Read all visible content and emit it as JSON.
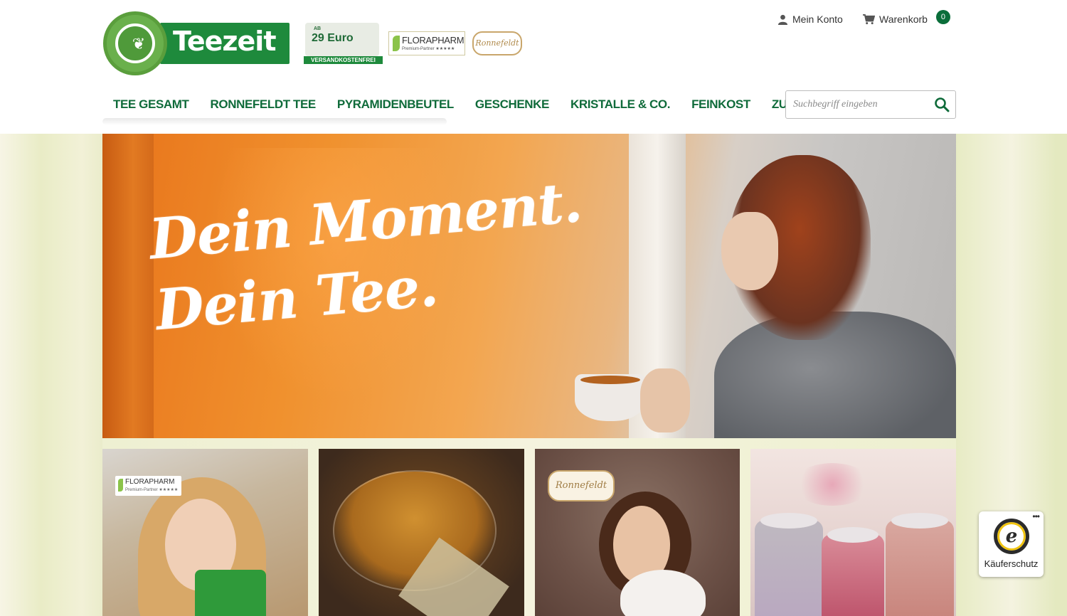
{
  "header": {
    "logo_text": "Teezeit",
    "shipping_badge": {
      "prefix": "AB",
      "amount": "29 Euro",
      "strip": "VERSANDKOSTENFREI"
    },
    "florapharm_badge": {
      "name": "FLORAPHARM",
      "sub": "Premium-Partner ★★★★★"
    },
    "ronnefeldt_badge": "Ronnefeldt",
    "account_label": "Mein Konto",
    "cart_label": "Warenkorb",
    "cart_count": "0"
  },
  "nav": {
    "items": [
      {
        "label": "TEE GESAMT"
      },
      {
        "label": "RONNEFELDT TEE"
      },
      {
        "label": "PYRAMIDENBEUTEL"
      },
      {
        "label": "GESCHENKE"
      },
      {
        "label": "KRISTALLE & CO."
      },
      {
        "label": "FEINKOST"
      },
      {
        "label": "ZUBEHÖR"
      }
    ]
  },
  "search": {
    "placeholder": "Suchbegriff eingeben",
    "value": ""
  },
  "hero": {
    "line1": "Dein Moment.",
    "line2": "Dein Tee."
  },
  "tiles": {
    "florapharm_badge": {
      "name": "FLORAPHARM",
      "sub": "Premium-Partner ★★★★★"
    },
    "ronnefeldt_badge": "Ronnefeldt"
  },
  "trusted": {
    "label": "Käuferschutz",
    "more": "•••"
  },
  "colors": {
    "brand_green": "#0f6b3a",
    "logo_green": "#1e8a3c",
    "cart_badge": "#0a6e3a"
  },
  "icons": {
    "account": "user-icon",
    "cart": "cart-icon",
    "search": "search-icon"
  }
}
